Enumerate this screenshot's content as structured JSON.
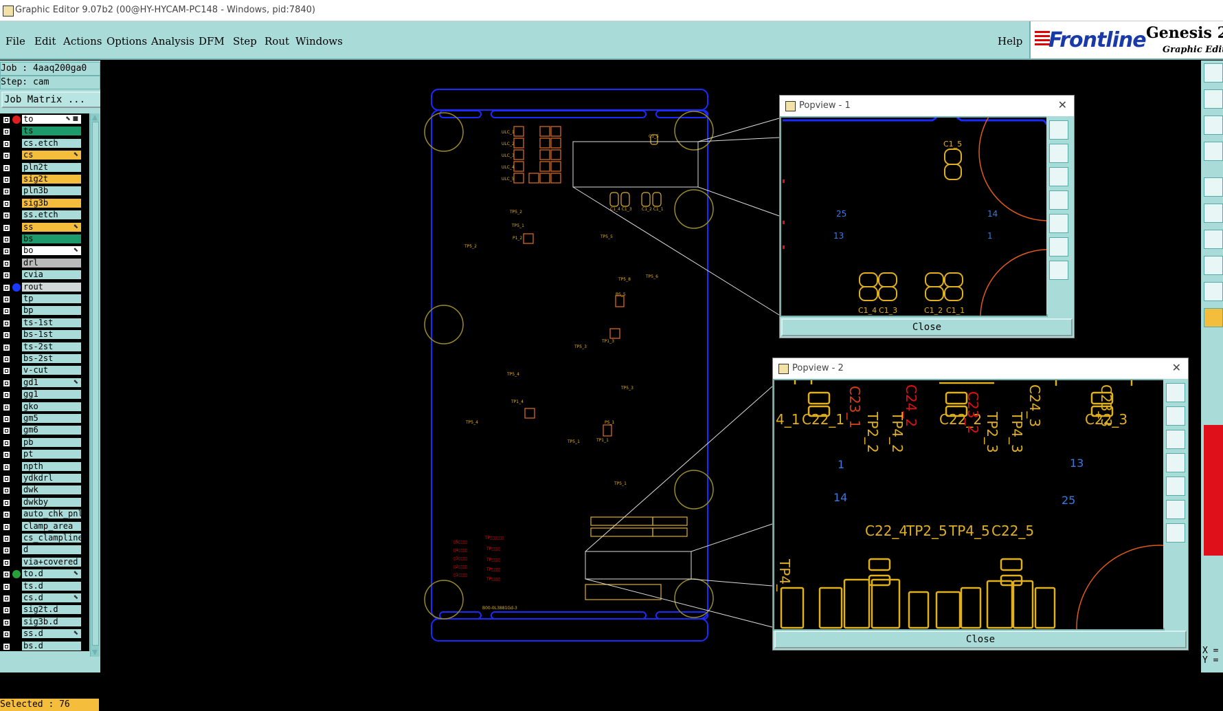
{
  "window": {
    "title": "Graphic Editor 9.07b2 (00@HY-HYCAM-PC148 - Windows, pid:7840)"
  },
  "menu": [
    {
      "label": "File"
    },
    {
      "label": "Edit"
    },
    {
      "label": "Actions"
    },
    {
      "label": "Options"
    },
    {
      "label": "Analysis"
    },
    {
      "label": "DFM"
    },
    {
      "label": "Step"
    },
    {
      "label": "Rout"
    },
    {
      "label": "Windows"
    }
  ],
  "help_label": "Help",
  "brand": {
    "logo": "Frontline",
    "product": "Genesis 20",
    "subtitle": "Graphic Editor"
  },
  "job": {
    "job_label": "Job : 4aaq200ga0",
    "step_label": "Step: cam",
    "matrix_button": "Job Matrix ..."
  },
  "layers": [
    {
      "name": "to",
      "style": "wh"
    },
    {
      "name": "ts",
      "style": "ts"
    },
    {
      "name": "cs.etch",
      "style": ""
    },
    {
      "name": "cs",
      "style": "cs"
    },
    {
      "name": "pln2t",
      "style": ""
    },
    {
      "name": "sig2t",
      "style": "cs"
    },
    {
      "name": "pln3b",
      "style": ""
    },
    {
      "name": "sig3b",
      "style": "cs"
    },
    {
      "name": "ss.etch",
      "style": ""
    },
    {
      "name": "ss",
      "style": "cs"
    },
    {
      "name": "bs",
      "style": "ts"
    },
    {
      "name": "bo",
      "style": "wh"
    },
    {
      "name": "drl",
      "style": "gr"
    },
    {
      "name": "cvia",
      "style": ""
    },
    {
      "name": "rout",
      "style": "lg"
    },
    {
      "name": "tp",
      "style": ""
    },
    {
      "name": "bp",
      "style": ""
    },
    {
      "name": "ts-1st",
      "style": ""
    },
    {
      "name": "bs-1st",
      "style": ""
    },
    {
      "name": "ts-2st",
      "style": ""
    },
    {
      "name": "bs-2st",
      "style": ""
    },
    {
      "name": "v-cut",
      "style": ""
    },
    {
      "name": "gd1",
      "style": ""
    },
    {
      "name": "gg1",
      "style": ""
    },
    {
      "name": "gko",
      "style": ""
    },
    {
      "name": "gm5",
      "style": ""
    },
    {
      "name": "gm6",
      "style": ""
    },
    {
      "name": "pb",
      "style": ""
    },
    {
      "name": "pt",
      "style": ""
    },
    {
      "name": "npth",
      "style": ""
    },
    {
      "name": "ydkdrl",
      "style": ""
    },
    {
      "name": "dwk",
      "style": ""
    },
    {
      "name": "dwkby",
      "style": ""
    },
    {
      "name": "auto_chk_pnl",
      "style": ""
    },
    {
      "name": "clamp_area",
      "style": ""
    },
    {
      "name": "cs_clampline",
      "style": ""
    },
    {
      "name": "d",
      "style": ""
    },
    {
      "name": "via+covered",
      "style": ""
    },
    {
      "name": "to.d",
      "style": ""
    },
    {
      "name": "ts.d",
      "style": ""
    },
    {
      "name": "cs.d",
      "style": ""
    },
    {
      "name": "sig2t.d",
      "style": ""
    },
    {
      "name": "sig3b.d",
      "style": ""
    },
    {
      "name": "ss.d",
      "style": ""
    },
    {
      "name": "bs.d",
      "style": ""
    }
  ],
  "selected_label": "Selected : 76",
  "coords": {
    "x": "X =",
    "y": "Y ="
  },
  "popview1": {
    "title": "Popview - 1",
    "close": "Close",
    "labels": [
      "C1_5",
      "C1_4",
      "C1_3",
      "C1_2",
      "C1_1",
      "25",
      "13",
      "14",
      "1"
    ]
  },
  "popview2": {
    "title": "Popview - 2",
    "close": "Close",
    "labels": [
      "4_1",
      "C22_1",
      "C23_1",
      "TP2_2",
      "TP4_2",
      "C24_2",
      "C22_2",
      "C23_2",
      "TP2_3",
      "TP4_3",
      "C24_3",
      "C22_3",
      "C23_3",
      "1",
      "13",
      "14",
      "25",
      "C22_4",
      "TP2_5",
      "TP4_5",
      "C22_5",
      "TP4_"
    ]
  },
  "board": {
    "footer_text": "B00-0L3881Gd-3"
  },
  "colors": {
    "panel": "#a9dcd9",
    "board_outline": "#1a2bff",
    "pad": "#d2691e",
    "hole": "#9a8a2a",
    "text_yellow": "#e0b020"
  }
}
